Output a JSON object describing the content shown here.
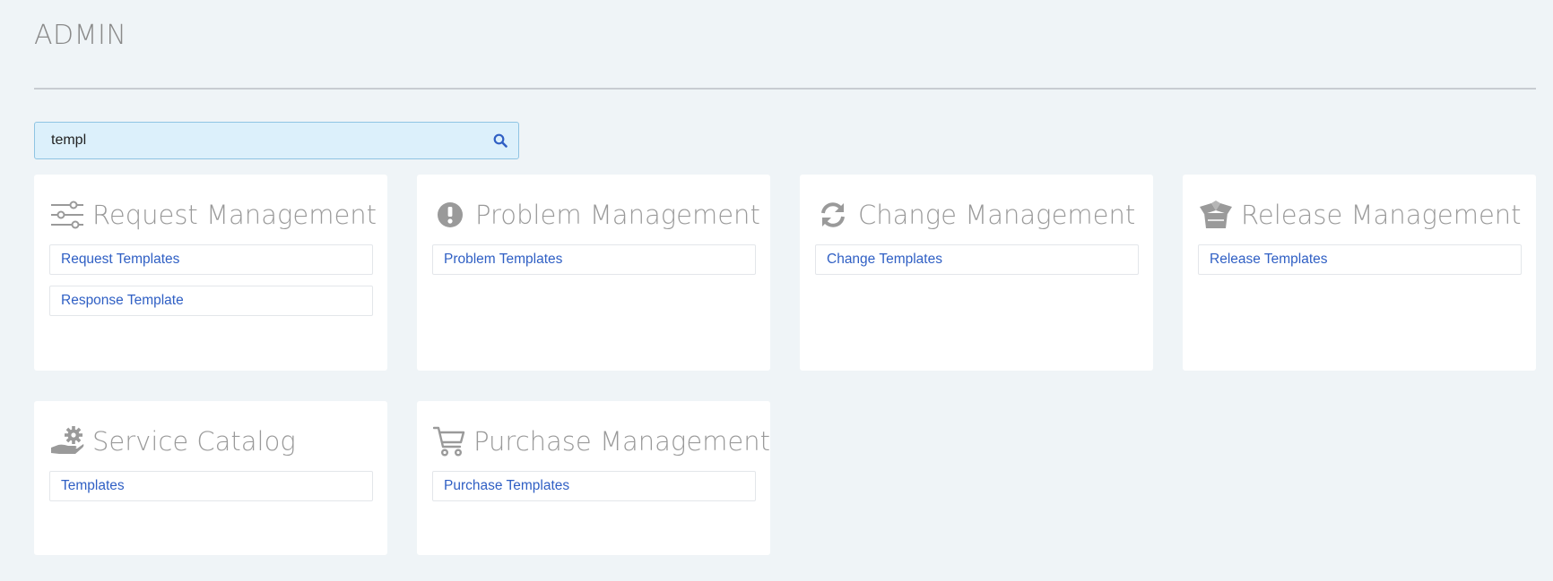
{
  "page": {
    "title": "ADMIN"
  },
  "search": {
    "value": "templ",
    "placeholder": ""
  },
  "cards": [
    {
      "title": "Request Management",
      "icon": "sliders-icon",
      "links": [
        "Request Templates",
        "Response Template"
      ]
    },
    {
      "title": "Problem Management",
      "icon": "exclamation-circle-icon",
      "links": [
        "Problem Templates"
      ]
    },
    {
      "title": "Change Management",
      "icon": "refresh-icon",
      "links": [
        "Change Templates"
      ]
    },
    {
      "title": "Release Management",
      "icon": "open-box-icon",
      "links": [
        "Release Templates"
      ]
    },
    {
      "title": "Service Catalog",
      "icon": "hand-gear-icon",
      "links": [
        "Templates"
      ]
    },
    {
      "title": "Purchase Management",
      "icon": "shopping-cart-icon",
      "links": [
        "Purchase Templates"
      ]
    }
  ],
  "colors": {
    "background": "#eff4f7",
    "link": "#2f5fc4",
    "icon": "#9a9a9a",
    "search_bg": "#dcf0fb"
  }
}
